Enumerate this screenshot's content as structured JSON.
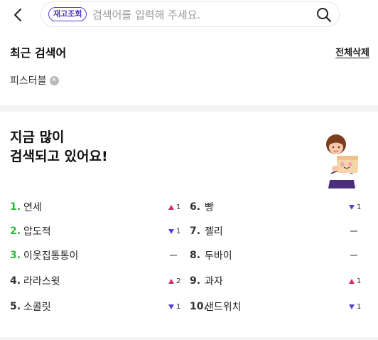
{
  "search": {
    "badge_label": "재고조회",
    "placeholder": "검색어를 입력해 주세요."
  },
  "recent": {
    "title": "최근 검색어",
    "clear_all": "전체삭제",
    "chips": [
      {
        "label": "피스터블"
      }
    ]
  },
  "trending": {
    "title_line1": "지금 많이",
    "title_line2": "검색되고 있어요!",
    "left": [
      {
        "rank": "1.",
        "term": "연세",
        "change": "up",
        "amount": "1"
      },
      {
        "rank": "2.",
        "term": "압도적",
        "change": "down",
        "amount": "1"
      },
      {
        "rank": "3.",
        "term": "이웃집통통이",
        "change": "none",
        "amount": ""
      },
      {
        "rank": "4.",
        "term": "라라스윗",
        "change": "up",
        "amount": "2"
      },
      {
        "rank": "5.",
        "term": "소콜릿",
        "change": "down",
        "amount": "1"
      }
    ],
    "right": [
      {
        "rank": "6.",
        "term": "빵",
        "change": "down",
        "amount": "1"
      },
      {
        "rank": "7.",
        "term": "젤리",
        "change": "none",
        "amount": ""
      },
      {
        "rank": "8.",
        "term": "두바이",
        "change": "none",
        "amount": ""
      },
      {
        "rank": "9.",
        "term": "과자",
        "change": "up",
        "amount": "1"
      },
      {
        "rank": "10.",
        "term": "샌드위치",
        "change": "down",
        "amount": "1"
      }
    ]
  },
  "colors": {
    "accent": "#5a3fd6",
    "top_rank": "#2fb83a",
    "rank_up": "#e0245e",
    "rank_down": "#5a3fd6"
  }
}
